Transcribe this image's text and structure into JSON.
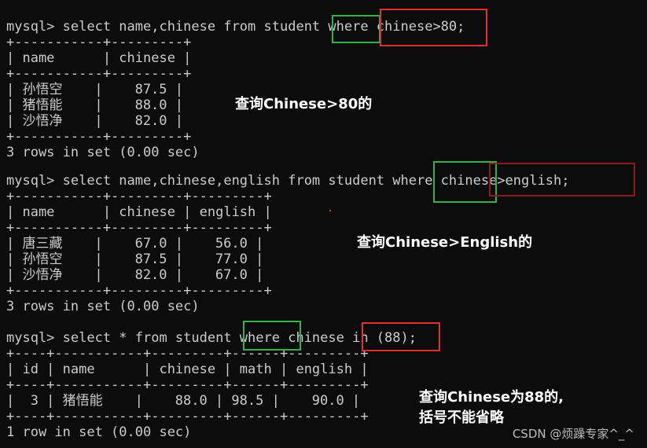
{
  "colors": {
    "background": "#0c0c0c",
    "text": "#cccccc",
    "note_text": "#ffffff",
    "highlight_green": "#2fb34a",
    "highlight_red": "#e03030",
    "highlight_darkred": "#8b1a1a"
  },
  "terminal": {
    "lines": [
      "mysql> select name,chinese from student where chinese>80;",
      "+-----------+---------+",
      "| name      | chinese |",
      "+-----------+---------+",
      "| 孙悟空    |    87.5 |",
      "| 猪悟能    |    88.0 |",
      "| 沙悟净    |    82.0 |",
      "+-----------+---------+",
      "3 rows in set (0.00 sec)",
      "",
      "mysql> select name,chinese,english from student where chinese>english;",
      "+-----------+---------+---------+",
      "| name      | chinese | english |",
      "+-----------+---------+---------+",
      "| 唐三藏    |    67.0 |    56.0 |",
      "| 孙悟空    |    87.5 |    77.0 |",
      "| 沙悟净    |    82.0 |    67.0 |",
      "+-----------+---------+---------+",
      "3 rows in set (0.00 sec)",
      "",
      "mysql> select * from student where chinese in (88);",
      "+----+-----------+---------+------+---------+",
      "| id | name      | chinese | math | english |",
      "+----+-----------+---------+------+---------+",
      "|  3 | 猪悟能    |    88.0 | 98.5 |    90.0 |",
      "+----+-----------+---------+------+---------+",
      "1 row in set (0.00 sec)"
    ]
  },
  "notes": {
    "note1": "查询Chinese>80的",
    "note2": "查询Chinese>English的",
    "note3": "查询Chinese为88的,\n括号不能省略"
  },
  "watermark": "CSDN @烦躁专家^_^"
}
